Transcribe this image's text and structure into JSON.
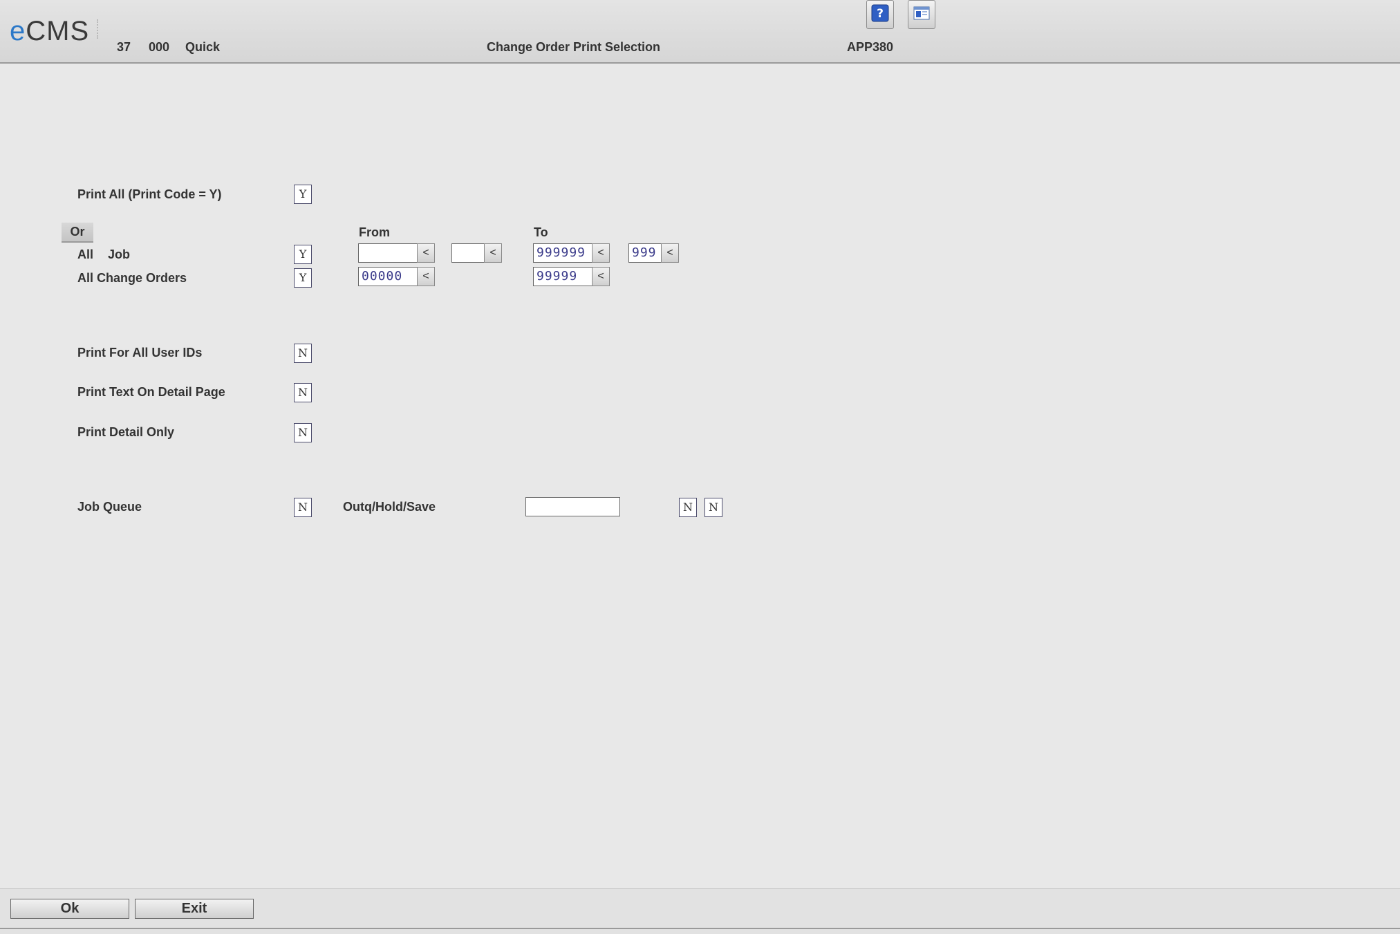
{
  "header": {
    "logo_e": "e",
    "logo_rest": "CMS",
    "company": "37",
    "division": "000",
    "mode": "Quick",
    "title": "Change Order Print Selection",
    "program": "APP380",
    "help_icon": "help-icon",
    "window_icon": "window-icon"
  },
  "form": {
    "print_all_label": "Print All (Print Code = Y)",
    "print_all_value": "Y",
    "or_label": "Or",
    "from_label": "From",
    "to_label": "To",
    "all_label": "All",
    "job_label": "Job",
    "all_jobs_value": "Y",
    "job_from": "",
    "job_from_sub": "",
    "job_to": "999999",
    "job_to_sub": "999",
    "all_change_orders_label": "All Change Orders",
    "all_change_orders_value": "Y",
    "co_from": "00000",
    "co_to": "99999",
    "print_all_users_label": "Print For All User IDs",
    "print_all_users_value": "N",
    "print_text_label": "Print Text On Detail Page",
    "print_text_value": "N",
    "print_detail_label": "Print Detail Only",
    "print_detail_value": "N",
    "job_queue_label": "Job Queue",
    "job_queue_value": "N",
    "outq_label": "Outq/Hold/Save",
    "outq_value": "",
    "hold_value": "N",
    "save_value": "N",
    "lookup_glyph": "<"
  },
  "footer": {
    "ok_label": "Ok",
    "exit_label": "Exit"
  }
}
